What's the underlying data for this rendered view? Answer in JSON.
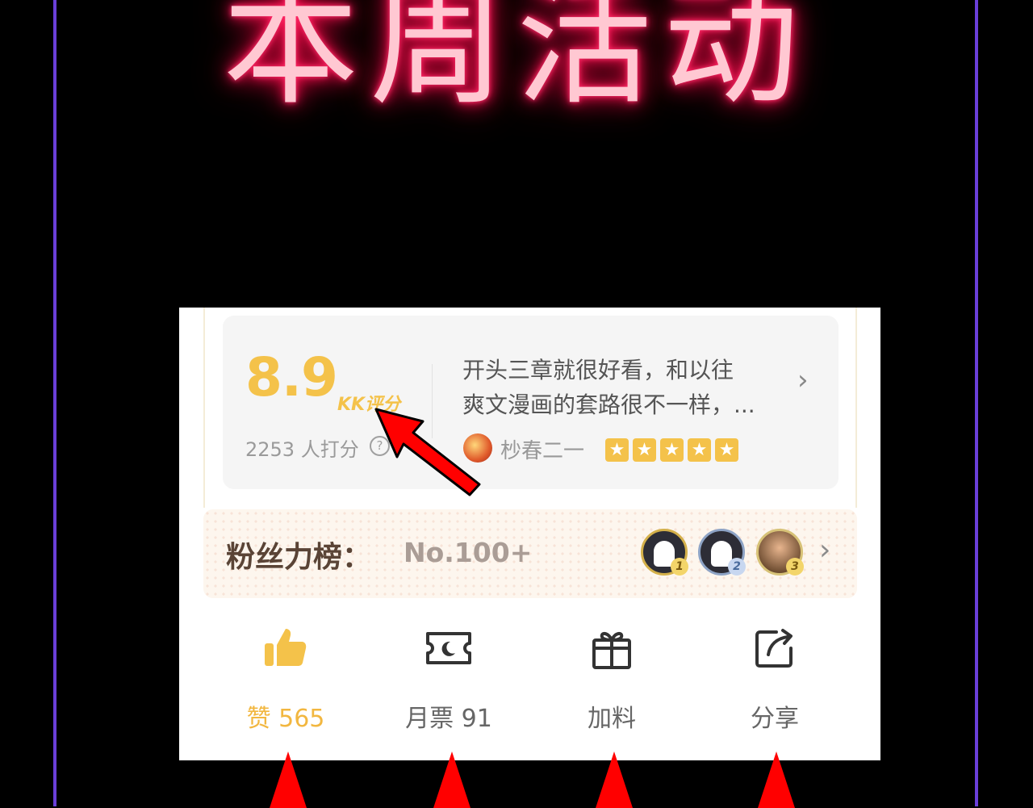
{
  "banner": {
    "title": "本周活动"
  },
  "colors": {
    "background": "#000000",
    "frame": "#6a3fd9",
    "neon": "#ff2d6a",
    "accent": "#f4c24a",
    "arrow": "#ff0000"
  },
  "rating": {
    "score": "8.9",
    "score_tag": "KK评分",
    "raters": "2253 人打分",
    "help_icon": "question-circle-icon"
  },
  "review": {
    "line1": "开头三章就很好看，和以往",
    "line2": "爽文漫画的套路很不一样，...",
    "reviewer_name": "杪春二一",
    "stars": 5
  },
  "fans": {
    "label": "粉丝力榜：",
    "rank": "No.100+",
    "avatars": [
      {
        "rank": "1"
      },
      {
        "rank": "2"
      },
      {
        "rank": "3"
      }
    ]
  },
  "actions": {
    "like": {
      "label": "赞 565",
      "icon": "thumbs-up-icon"
    },
    "monthly_ticket": {
      "label": "月票 91",
      "icon": "ticket-icon"
    },
    "gift": {
      "label": "加料",
      "icon": "gift-icon"
    },
    "share": {
      "label": "分享",
      "icon": "share-icon"
    }
  }
}
